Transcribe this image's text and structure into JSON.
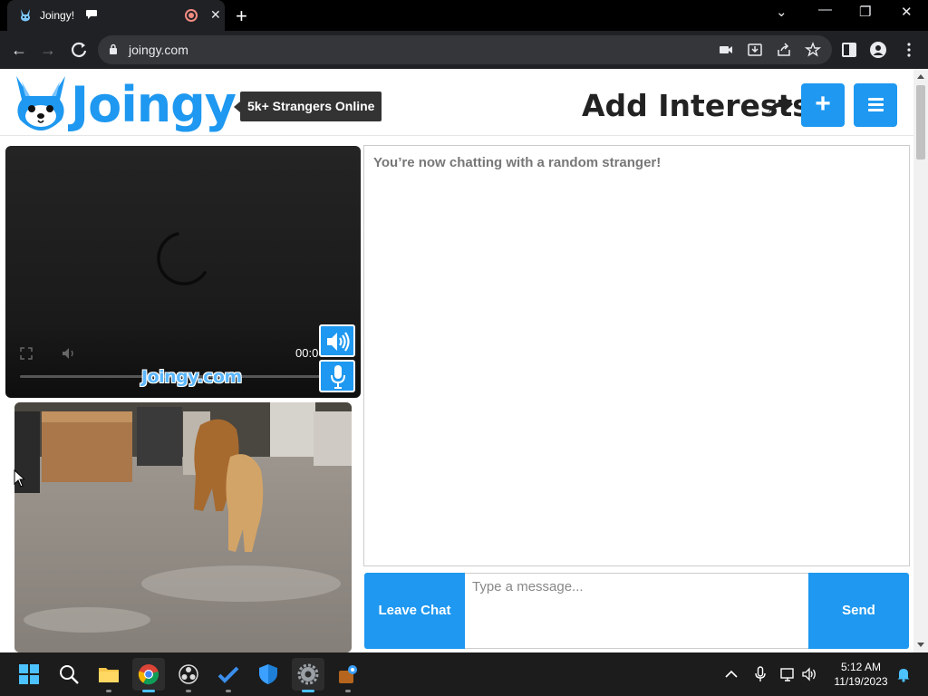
{
  "browser": {
    "tab_title": "Joingy!",
    "url": "joingy.com",
    "window_controls": [
      "chevron-down",
      "minimize",
      "restore",
      "close"
    ]
  },
  "header": {
    "logo_text": "Joingy",
    "online_badge": "5k+ Strangers Online",
    "add_interests": "Add Interests",
    "plus_label": "+",
    "brand_color": "#1e98f0"
  },
  "video": {
    "time": "00:0",
    "watermark": "Joingy.com"
  },
  "chat": {
    "status": "You’re now chatting with a random stranger!",
    "leave_label": "Leave Chat",
    "input_placeholder": "Type a message...",
    "input_value": "",
    "send_label": "Send"
  },
  "taskbar": {
    "apps": [
      "windows-start",
      "search",
      "file-explorer",
      "chrome",
      "obs",
      "todo",
      "defender",
      "settings",
      "other-app"
    ],
    "time": "5:12 AM",
    "date": "11/19/2023"
  }
}
